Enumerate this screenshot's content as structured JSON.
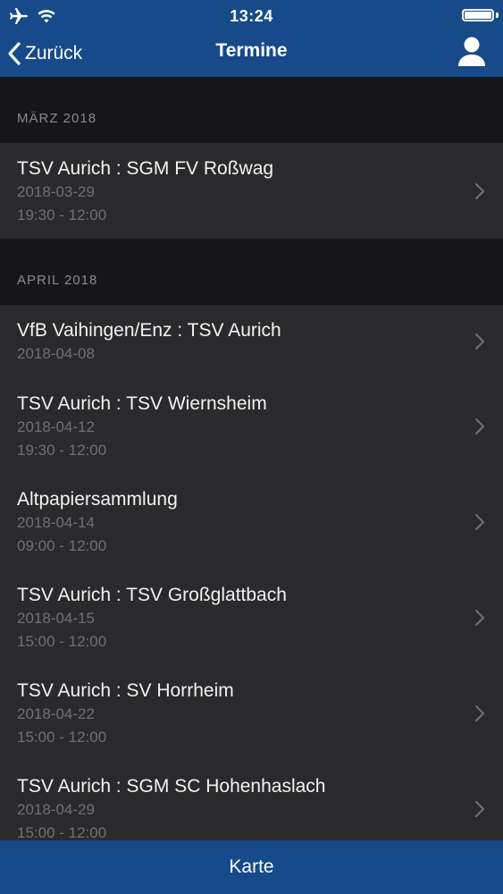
{
  "status": {
    "time": "13:24"
  },
  "nav": {
    "back_label": "Zurück",
    "title": "Termine"
  },
  "sections": [
    {
      "header": "MÄRZ 2018",
      "items": [
        {
          "title": "TSV Aurich : SGM FV Roßwag",
          "date": "2018-03-29",
          "time": "19:30 - 12:00"
        }
      ]
    },
    {
      "header": "APRIL 2018",
      "items": [
        {
          "title": "VfB Vaihingen/Enz : TSV Aurich",
          "date": "2018-04-08",
          "time": ""
        },
        {
          "title": "TSV Aurich : TSV Wiernsheim",
          "date": "2018-04-12",
          "time": "19:30 - 12:00"
        },
        {
          "title": "Altpapiersammlung",
          "date": "2018-04-14",
          "time": "09:00 - 12:00"
        },
        {
          "title": "TSV Aurich : TSV Großglattbach",
          "date": "2018-04-15",
          "time": "15:00 - 12:00"
        },
        {
          "title": "TSV Aurich : SV Horrheim",
          "date": "2018-04-22",
          "time": "15:00 - 12:00"
        },
        {
          "title": "TSV Aurich : SGM SC Hohenhaslach",
          "date": "2018-04-29",
          "time": "15:00 - 12:00"
        }
      ]
    }
  ],
  "bottom": {
    "label": "Karte"
  },
  "colors": {
    "accent": "#164a8a",
    "background": "#2a2a2d",
    "section_bg": "#161618"
  }
}
